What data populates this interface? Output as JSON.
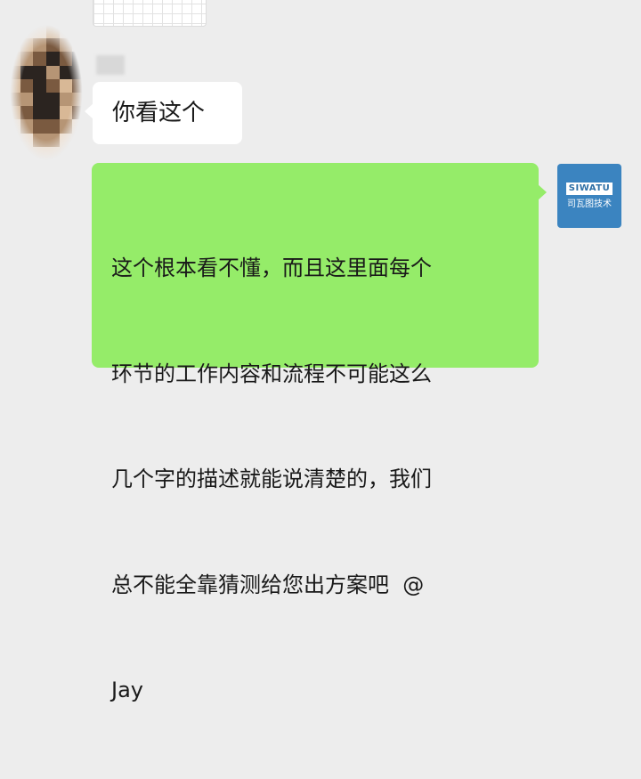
{
  "prev_message": {
    "type": "image"
  },
  "incoming": {
    "avatar": {
      "obscured": true,
      "colors": [
        "#d8b896",
        "#b69575",
        "#7a5a40",
        "#2b2420",
        "#efdfcf"
      ]
    },
    "text": "你看这个"
  },
  "outgoing": {
    "lines": [
      "这个根本看不懂，而且这里面每个",
      "环节的工作内容和流程不可能这么",
      "几个字的描述就能说清楚的，我们",
      "总不能全靠猜测给您出方案吧  @",
      "Jay"
    ],
    "bubble_color": "#95ec69",
    "avatar": {
      "logo_text": "SIWATU",
      "caption": "司瓦图技术",
      "color": "#3b84c0"
    }
  }
}
